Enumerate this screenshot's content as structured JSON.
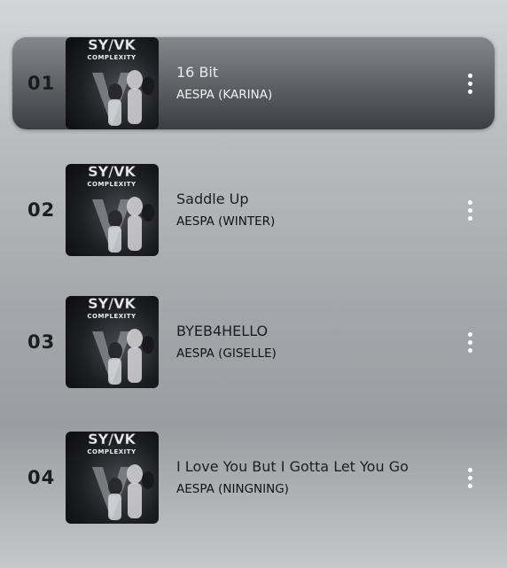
{
  "colors": {
    "active_row_top": "#84878b",
    "active_row_bottom": "#3b3e43",
    "dots": "#ffffff"
  },
  "tracks": [
    {
      "number": "01",
      "title": "16 Bit",
      "artist": "AESPA (KARINA)",
      "active": true,
      "album_art_label": "SYNK COMPLEXITY",
      "more_icon": "more-vertical-icon"
    },
    {
      "number": "02",
      "title": "Saddle Up",
      "artist": "AESPA (WINTER)",
      "active": false,
      "album_art_label": "SYNK COMPLEXITY",
      "more_icon": "more-vertical-icon"
    },
    {
      "number": "03",
      "title": "BYEB4HELLO",
      "artist": "AESPA (GISELLE)",
      "active": false,
      "album_art_label": "SYNK COMPLEXITY",
      "more_icon": "more-vertical-icon"
    },
    {
      "number": "04",
      "title": "I Love You But I Gotta Let You Go",
      "artist": "AESPA (NINGNING)",
      "active": false,
      "album_art_label": "SYNK COMPLEXITY",
      "more_icon": "more-vertical-icon"
    }
  ]
}
